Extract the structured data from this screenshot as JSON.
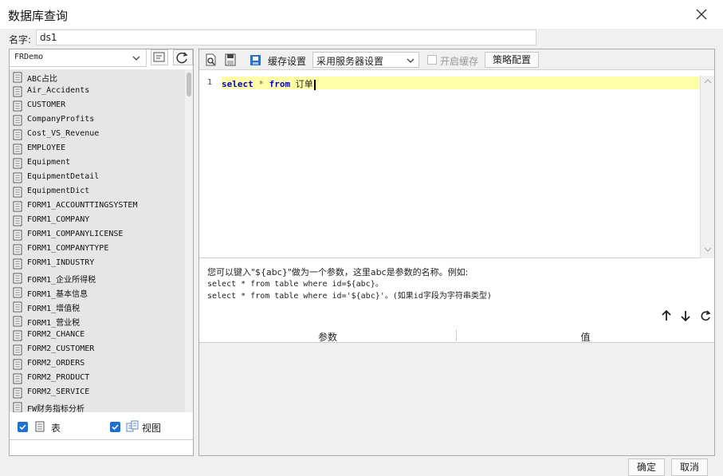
{
  "window": {
    "title": "数据库查询"
  },
  "name_row": {
    "label": "名字:",
    "value": "ds1"
  },
  "datasource": {
    "selected": "FRDemo"
  },
  "tables": [
    "ABC占比",
    "Air_Accidents",
    "CUSTOMER",
    "CompanyProfits",
    "Cost_VS_Revenue",
    "EMPLOYEE",
    "Equipment",
    "EquipmentDetail",
    "EquipmentDict",
    "FORM1_ACCOUNTTINGSYSTEM",
    "FORM1_COMPANY",
    "FORM1_COMPANYLICENSE",
    "FORM1_COMPANYTYPE",
    "FORM1_INDUSTRY",
    "FORM1_企业所得税",
    "FORM1_基本信息",
    "FORM1_增值税",
    "FORM1_营业税",
    "FORM2_CHANCE",
    "FORM2_CUSTOMER",
    "FORM2_ORDERS",
    "FORM2_PRODUCT",
    "FORM2_SERVICE",
    "FW财务指标分析"
  ],
  "filters": {
    "table_label": "表",
    "view_label": "视图"
  },
  "toolbar": {
    "cache_settings_label": "缓存设置",
    "cache_option": "采用服务器设置",
    "enable_cache_label": "开启缓存",
    "policy_button": "策略配置"
  },
  "editor": {
    "line_number": "1",
    "kw_select": "select",
    "star": " * ",
    "kw_from": "from",
    "table_name": " 订单"
  },
  "hint": {
    "line1": "您可以键入\"${abc}\"做为一个参数，这里abc是参数的名称。例如:",
    "line2": "select * from table where id=${abc}。",
    "line3": "select * from table where id='${abc}'。(如果id字段为字符串类型)"
  },
  "params_table": {
    "col_param": "参数",
    "col_value": "值"
  },
  "footer": {
    "ok": "确定",
    "cancel": "取消"
  },
  "colors": {
    "accent": "#1e6fd0",
    "keyword": "#0000c8",
    "active_line": "#ffffaa"
  }
}
